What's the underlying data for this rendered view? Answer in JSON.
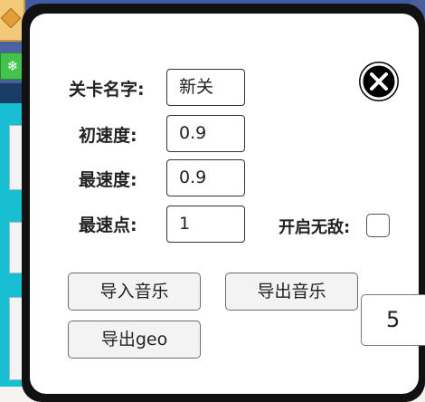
{
  "dialog": {
    "fields": {
      "level_name": {
        "label": "关卡名字:",
        "value": "新关"
      },
      "initial_speed": {
        "label": "初速度:",
        "value": "0.9"
      },
      "max_speed": {
        "label": "最速度:",
        "value": "0.9"
      },
      "max_speed_point": {
        "label": "最速点:",
        "value": "1"
      }
    },
    "invincible": {
      "label": "开启无敌:",
      "checked": false
    },
    "buttons": {
      "import_music": "导入音乐",
      "export_music": "导出音乐",
      "export_geo": "导出geo"
    },
    "side_number": "5",
    "close_icon": "close-circle-icon"
  },
  "background": {
    "green_tile_glyph": "❄"
  },
  "colors": {
    "dialog_border": "#111111",
    "scene_blue": "#4b5f9c",
    "scene_cyan": "#18bfd3"
  }
}
